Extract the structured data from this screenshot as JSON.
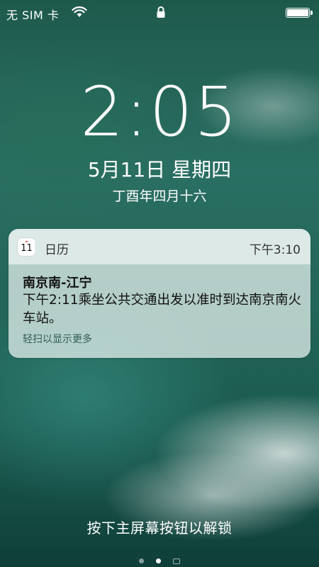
{
  "status_bar": {
    "carrier": "无 SIM 卡",
    "wifi_icon": "wifi-icon",
    "lock_icon": "lock-icon",
    "battery_icon": "battery-icon",
    "battery_level": 1.0
  },
  "lock_screen": {
    "time": "2:05",
    "date": "5月11日 星期四",
    "lunar_date": "丁酉年四月十六"
  },
  "notification": {
    "app_icon": "calendar-icon",
    "app_icon_day": "11",
    "app_name": "日历",
    "time": "下午3:10",
    "title": "南京南-江宁",
    "body": "下午2:11乘坐公共交通出发以准时到达南京南火车站。",
    "action_hint": "轻扫以显示更多"
  },
  "unlock_prompt": "按下主屏幕按钮以解锁",
  "page_indicator": {
    "pages": [
      "dot",
      "dot",
      "camera"
    ],
    "active_index": 1
  }
}
